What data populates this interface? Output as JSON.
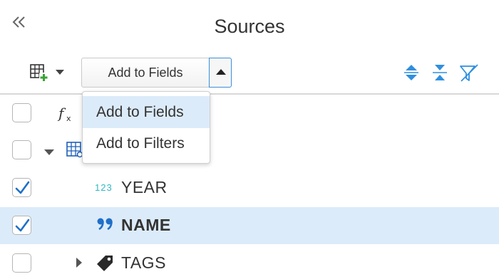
{
  "header": {
    "title": "Sources",
    "collapse_icon": "double-chevron-left-icon"
  },
  "toolbar": {
    "add_table_icon": "table-plus-icon",
    "dropdown_value": "Add to Fields",
    "dropdown_open": true,
    "icons": [
      "sort-ascending-icon",
      "collapse-all-icon",
      "filter-remove-icon"
    ]
  },
  "menu": {
    "items": [
      {
        "label": "Add to Fields",
        "highlighted": true
      },
      {
        "label": "Add to Filters",
        "highlighted": false
      }
    ]
  },
  "rows": [
    {
      "icon": "function-icon",
      "label": "",
      "checked": false,
      "expandable": false
    },
    {
      "icon": "table-icon",
      "label": "",
      "checked": false,
      "expandable": true,
      "expanded": true
    },
    {
      "icon": "number-type-icon",
      "icon_text": "123",
      "label": "YEAR",
      "checked": true,
      "expandable": false
    },
    {
      "icon": "text-type-icon",
      "label": "NAME",
      "checked": true,
      "selected": true,
      "expandable": false
    },
    {
      "icon": "tag-icon",
      "label": "TAGS",
      "checked": false,
      "expandable": true,
      "expanded": false
    }
  ],
  "colors": {
    "accent": "#2f8fe0",
    "selection": "#dcebf9",
    "checkmark": "#1f6fc9",
    "number_icon": "#2fb8c6",
    "plus_green": "#3aa335"
  }
}
